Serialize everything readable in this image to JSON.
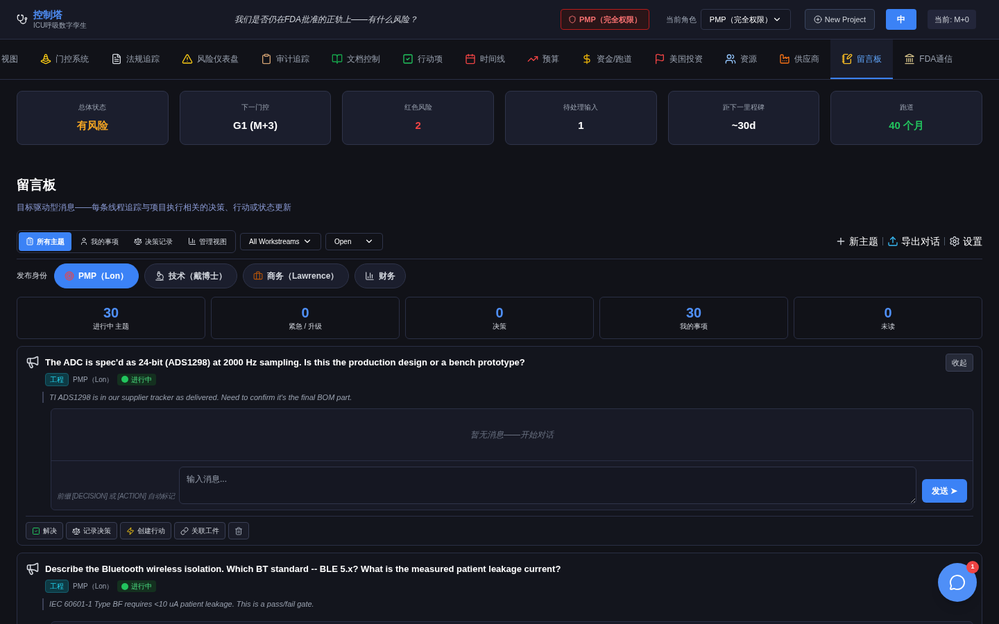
{
  "header": {
    "logo_title": "控制塔",
    "logo_subtitle": "ICU呼吸数字孪生",
    "tagline": "我们是否仍在FDA批准的正轨上——有什么风险？",
    "role_badge": "PMP（完全权限）",
    "role_label": "当前角色",
    "role_select": "PMP（完全权限）",
    "new_project": "New Project",
    "lang_button": "中",
    "current": "当前: M+0"
  },
  "nav": [
    {
      "label": "视图",
      "selected": false
    },
    {
      "label": "门控系统",
      "selected": false
    },
    {
      "label": "法规追踪",
      "selected": false
    },
    {
      "label": "风险仪表盘",
      "selected": false
    },
    {
      "label": "审计追踪",
      "selected": false
    },
    {
      "label": "文档控制",
      "selected": false
    },
    {
      "label": "行动项",
      "selected": false
    },
    {
      "label": "时间线",
      "selected": false
    },
    {
      "label": "预算",
      "selected": false
    },
    {
      "label": "资金/跑道",
      "selected": false
    },
    {
      "label": "美国投资",
      "selected": false
    },
    {
      "label": "资源",
      "selected": false
    },
    {
      "label": "供应商",
      "selected": false
    },
    {
      "label": "留言板",
      "selected": true
    },
    {
      "label": "FDA通信",
      "selected": false
    }
  ],
  "stats": [
    {
      "label": "总体状态",
      "value": "有风险",
      "color": "#f5a623"
    },
    {
      "label": "下一门控",
      "value": "G1 (M+3)",
      "color": "#ffffff"
    },
    {
      "label": "红色风险",
      "value": "2",
      "color": "#ef4444"
    },
    {
      "label": "待处理输入",
      "value": "1",
      "color": "#ffffff"
    },
    {
      "label": "距下一里程碑",
      "value": "~30d",
      "color": "#ffffff"
    },
    {
      "label": "跑道",
      "value": "40 个月",
      "color": "#22c55e"
    }
  ],
  "page_title": "留言板",
  "page_subtitle": "目标驱动型消息——每条线程追踪与项目执行相关的决策、行动或状态更新",
  "view_tabs": [
    {
      "label": "所有主题",
      "selected": true
    },
    {
      "label": "我的事项",
      "selected": false
    },
    {
      "label": "决策记录",
      "selected": false
    },
    {
      "label": "管理视图",
      "selected": false
    }
  ],
  "filters": [
    "All Workstreams",
    "Open"
  ],
  "actions": [
    "新主题",
    "导出对话",
    "设置"
  ],
  "post_as_label": "发布身份",
  "identities": [
    {
      "label": "PMP（Lon）",
      "selected": true
    },
    {
      "label": "技术（戴博士）",
      "selected": false
    },
    {
      "label": "商务（Lawrence）",
      "selected": false
    },
    {
      "label": "财务",
      "selected": false
    }
  ],
  "counters": [
    {
      "value": "30",
      "label": "进行中 主题"
    },
    {
      "value": "0",
      "label": "紧急 / 升级"
    },
    {
      "value": "0",
      "label": "决策"
    },
    {
      "value": "30",
      "label": "我的事项"
    },
    {
      "value": "0",
      "label": "未读"
    }
  ],
  "threads": [
    {
      "title": "The ADC is spec'd as 24-bit (ADS1298) at 2000 Hz sampling. Is this the production design or a bench prototype?",
      "tag": "工程",
      "author": "PMP（Lon）",
      "status": "进行中",
      "note": "TI ADS1298 is in our supplier tracker as delivered. Need to confirm it's the final BOM part.",
      "expanded": true,
      "collapse": "收起",
      "empty": "暂无消息——开始对话",
      "hint": "前缀 [DECISION] 或 [ACTION] 自动标记",
      "placeholder": "输入消息...",
      "send": "发送 ➤",
      "buttons": [
        "解决",
        "记录决策",
        "创建行动",
        "关联工件"
      ]
    },
    {
      "title": "Describe the Bluetooth wireless isolation. Which BT standard -- BLE 5.x? What is the measured patient leakage current?",
      "tag": "工程",
      "author": "PMP（Lon）",
      "status": "进行中",
      "note": "IEC 60601-1 Type BF requires <10 uA patient leakage. This is a pass/fail gate.",
      "expanded": false
    }
  ],
  "chat_badge": "1"
}
